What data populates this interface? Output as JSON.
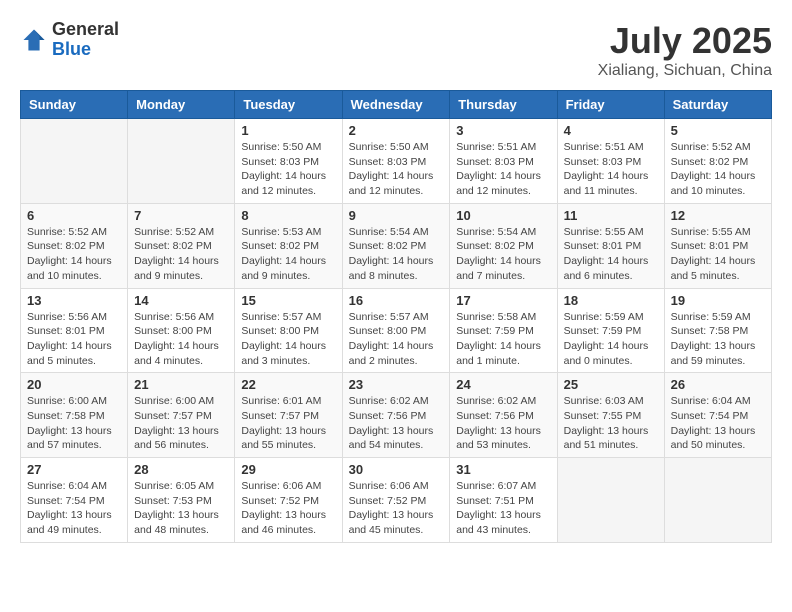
{
  "header": {
    "logo_general": "General",
    "logo_blue": "Blue",
    "month_title": "July 2025",
    "location": "Xialiang, Sichuan, China"
  },
  "days_of_week": [
    "Sunday",
    "Monday",
    "Tuesday",
    "Wednesday",
    "Thursday",
    "Friday",
    "Saturday"
  ],
  "weeks": [
    [
      {
        "day": "",
        "sunrise": "",
        "sunset": "",
        "daylight": ""
      },
      {
        "day": "",
        "sunrise": "",
        "sunset": "",
        "daylight": ""
      },
      {
        "day": "1",
        "sunrise": "Sunrise: 5:50 AM",
        "sunset": "Sunset: 8:03 PM",
        "daylight": "Daylight: 14 hours and 12 minutes."
      },
      {
        "day": "2",
        "sunrise": "Sunrise: 5:50 AM",
        "sunset": "Sunset: 8:03 PM",
        "daylight": "Daylight: 14 hours and 12 minutes."
      },
      {
        "day": "3",
        "sunrise": "Sunrise: 5:51 AM",
        "sunset": "Sunset: 8:03 PM",
        "daylight": "Daylight: 14 hours and 12 minutes."
      },
      {
        "day": "4",
        "sunrise": "Sunrise: 5:51 AM",
        "sunset": "Sunset: 8:03 PM",
        "daylight": "Daylight: 14 hours and 11 minutes."
      },
      {
        "day": "5",
        "sunrise": "Sunrise: 5:52 AM",
        "sunset": "Sunset: 8:02 PM",
        "daylight": "Daylight: 14 hours and 10 minutes."
      }
    ],
    [
      {
        "day": "6",
        "sunrise": "Sunrise: 5:52 AM",
        "sunset": "Sunset: 8:02 PM",
        "daylight": "Daylight: 14 hours and 10 minutes."
      },
      {
        "day": "7",
        "sunrise": "Sunrise: 5:52 AM",
        "sunset": "Sunset: 8:02 PM",
        "daylight": "Daylight: 14 hours and 9 minutes."
      },
      {
        "day": "8",
        "sunrise": "Sunrise: 5:53 AM",
        "sunset": "Sunset: 8:02 PM",
        "daylight": "Daylight: 14 hours and 9 minutes."
      },
      {
        "day": "9",
        "sunrise": "Sunrise: 5:54 AM",
        "sunset": "Sunset: 8:02 PM",
        "daylight": "Daylight: 14 hours and 8 minutes."
      },
      {
        "day": "10",
        "sunrise": "Sunrise: 5:54 AM",
        "sunset": "Sunset: 8:02 PM",
        "daylight": "Daylight: 14 hours and 7 minutes."
      },
      {
        "day": "11",
        "sunrise": "Sunrise: 5:55 AM",
        "sunset": "Sunset: 8:01 PM",
        "daylight": "Daylight: 14 hours and 6 minutes."
      },
      {
        "day": "12",
        "sunrise": "Sunrise: 5:55 AM",
        "sunset": "Sunset: 8:01 PM",
        "daylight": "Daylight: 14 hours and 5 minutes."
      }
    ],
    [
      {
        "day": "13",
        "sunrise": "Sunrise: 5:56 AM",
        "sunset": "Sunset: 8:01 PM",
        "daylight": "Daylight: 14 hours and 5 minutes."
      },
      {
        "day": "14",
        "sunrise": "Sunrise: 5:56 AM",
        "sunset": "Sunset: 8:00 PM",
        "daylight": "Daylight: 14 hours and 4 minutes."
      },
      {
        "day": "15",
        "sunrise": "Sunrise: 5:57 AM",
        "sunset": "Sunset: 8:00 PM",
        "daylight": "Daylight: 14 hours and 3 minutes."
      },
      {
        "day": "16",
        "sunrise": "Sunrise: 5:57 AM",
        "sunset": "Sunset: 8:00 PM",
        "daylight": "Daylight: 14 hours and 2 minutes."
      },
      {
        "day": "17",
        "sunrise": "Sunrise: 5:58 AM",
        "sunset": "Sunset: 7:59 PM",
        "daylight": "Daylight: 14 hours and 1 minute."
      },
      {
        "day": "18",
        "sunrise": "Sunrise: 5:59 AM",
        "sunset": "Sunset: 7:59 PM",
        "daylight": "Daylight: 14 hours and 0 minutes."
      },
      {
        "day": "19",
        "sunrise": "Sunrise: 5:59 AM",
        "sunset": "Sunset: 7:58 PM",
        "daylight": "Daylight: 13 hours and 59 minutes."
      }
    ],
    [
      {
        "day": "20",
        "sunrise": "Sunrise: 6:00 AM",
        "sunset": "Sunset: 7:58 PM",
        "daylight": "Daylight: 13 hours and 57 minutes."
      },
      {
        "day": "21",
        "sunrise": "Sunrise: 6:00 AM",
        "sunset": "Sunset: 7:57 PM",
        "daylight": "Daylight: 13 hours and 56 minutes."
      },
      {
        "day": "22",
        "sunrise": "Sunrise: 6:01 AM",
        "sunset": "Sunset: 7:57 PM",
        "daylight": "Daylight: 13 hours and 55 minutes."
      },
      {
        "day": "23",
        "sunrise": "Sunrise: 6:02 AM",
        "sunset": "Sunset: 7:56 PM",
        "daylight": "Daylight: 13 hours and 54 minutes."
      },
      {
        "day": "24",
        "sunrise": "Sunrise: 6:02 AM",
        "sunset": "Sunset: 7:56 PM",
        "daylight": "Daylight: 13 hours and 53 minutes."
      },
      {
        "day": "25",
        "sunrise": "Sunrise: 6:03 AM",
        "sunset": "Sunset: 7:55 PM",
        "daylight": "Daylight: 13 hours and 51 minutes."
      },
      {
        "day": "26",
        "sunrise": "Sunrise: 6:04 AM",
        "sunset": "Sunset: 7:54 PM",
        "daylight": "Daylight: 13 hours and 50 minutes."
      }
    ],
    [
      {
        "day": "27",
        "sunrise": "Sunrise: 6:04 AM",
        "sunset": "Sunset: 7:54 PM",
        "daylight": "Daylight: 13 hours and 49 minutes."
      },
      {
        "day": "28",
        "sunrise": "Sunrise: 6:05 AM",
        "sunset": "Sunset: 7:53 PM",
        "daylight": "Daylight: 13 hours and 48 minutes."
      },
      {
        "day": "29",
        "sunrise": "Sunrise: 6:06 AM",
        "sunset": "Sunset: 7:52 PM",
        "daylight": "Daylight: 13 hours and 46 minutes."
      },
      {
        "day": "30",
        "sunrise": "Sunrise: 6:06 AM",
        "sunset": "Sunset: 7:52 PM",
        "daylight": "Daylight: 13 hours and 45 minutes."
      },
      {
        "day": "31",
        "sunrise": "Sunrise: 6:07 AM",
        "sunset": "Sunset: 7:51 PM",
        "daylight": "Daylight: 13 hours and 43 minutes."
      },
      {
        "day": "",
        "sunrise": "",
        "sunset": "",
        "daylight": ""
      },
      {
        "day": "",
        "sunrise": "",
        "sunset": "",
        "daylight": ""
      }
    ]
  ]
}
